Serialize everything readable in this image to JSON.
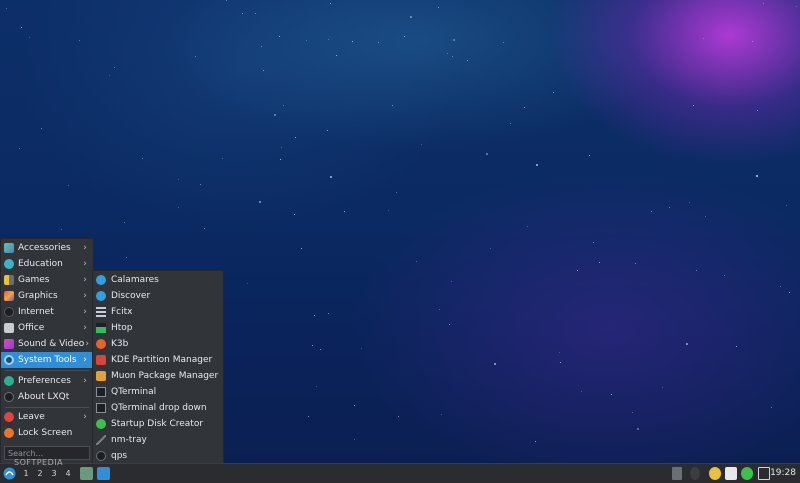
{
  "main_menu": {
    "items": [
      {
        "label": "Accessories",
        "icon": "accessories-icon",
        "has_submenu": true
      },
      {
        "label": "Education",
        "icon": "education-icon",
        "has_submenu": true
      },
      {
        "label": "Games",
        "icon": "games-icon",
        "has_submenu": true
      },
      {
        "label": "Graphics",
        "icon": "graphics-icon",
        "has_submenu": true
      },
      {
        "label": "Internet",
        "icon": "internet-icon",
        "has_submenu": true
      },
      {
        "label": "Office",
        "icon": "office-icon",
        "has_submenu": true
      },
      {
        "label": "Sound & Video",
        "icon": "sound-video-icon",
        "has_submenu": true
      },
      {
        "label": "System Tools",
        "icon": "system-tools-icon",
        "has_submenu": true,
        "active": true
      },
      {
        "label": "Preferences",
        "icon": "preferences-icon",
        "has_submenu": true
      },
      {
        "label": "About LXQt",
        "icon": "about-icon",
        "has_submenu": false
      },
      {
        "label": "Leave",
        "icon": "leave-icon",
        "has_submenu": true
      },
      {
        "label": "Lock Screen",
        "icon": "lock-icon",
        "has_submenu": false
      }
    ],
    "search_placeholder": "Search...",
    "arrow": "›"
  },
  "submenu": {
    "items": [
      {
        "label": "Calamares",
        "icon": "calamares-icon"
      },
      {
        "label": "Discover",
        "icon": "discover-icon"
      },
      {
        "label": "Fcitx",
        "icon": "fcitx-icon"
      },
      {
        "label": "Htop",
        "icon": "htop-icon"
      },
      {
        "label": "K3b",
        "icon": "k3b-icon"
      },
      {
        "label": "KDE Partition Manager",
        "icon": "partition-manager-icon"
      },
      {
        "label": "Muon Package Manager",
        "icon": "muon-icon"
      },
      {
        "label": "QTerminal",
        "icon": "terminal-icon"
      },
      {
        "label": "QTerminal drop down",
        "icon": "terminal-dropdown-icon"
      },
      {
        "label": "Startup Disk Creator",
        "icon": "startup-disk-icon"
      },
      {
        "label": "nm-tray",
        "icon": "nm-tray-icon"
      },
      {
        "label": "qps",
        "icon": "qps-icon"
      }
    ]
  },
  "taskbar": {
    "workspaces": [
      "1",
      "2",
      "3",
      "4"
    ],
    "clock": "19:28",
    "watermark": "SOFTPEDIA"
  },
  "colors": {
    "menu_bg": "#313438",
    "highlight": "#2f8fd8",
    "taskbar_bg": "#2a2c30"
  }
}
